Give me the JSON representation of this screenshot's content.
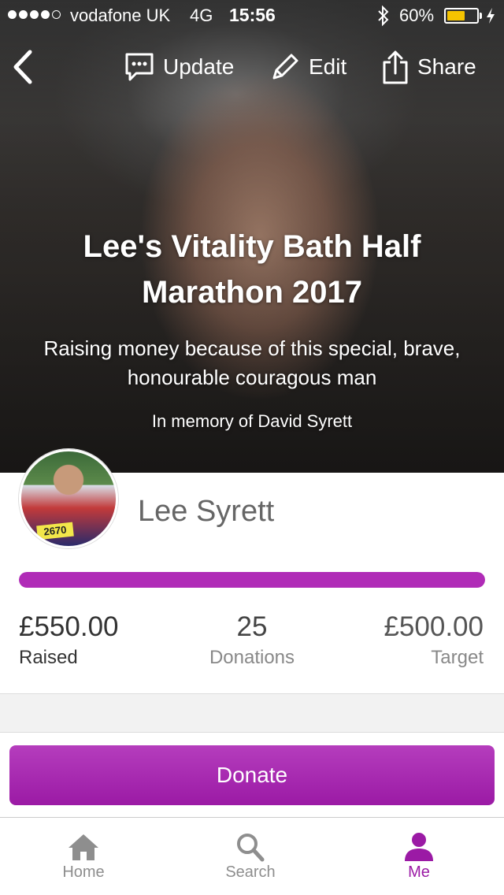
{
  "status_bar": {
    "carrier": "vodafone UK",
    "network": "4G",
    "time": "15:56",
    "battery_percent": "60%",
    "battery_level": 0.6,
    "signal_bars": 4,
    "signal_total": 5
  },
  "toolbar": {
    "update_label": "Update",
    "edit_label": "Edit",
    "share_label": "Share"
  },
  "hero": {
    "title": "Lee's Vitality Bath Half Marathon 2017",
    "subtitle": "Raising money because of this special, brave, honourable couragous man",
    "memory": "In memory of David Syrett"
  },
  "profile": {
    "name": "Lee Syrett",
    "avatar_bib": "2670"
  },
  "progress": {
    "fraction": 1.0
  },
  "stats": {
    "raised_value": "£550.00",
    "raised_label": "Raised",
    "donations_value": "25",
    "donations_label": "Donations",
    "target_value": "£500.00",
    "target_label": "Target"
  },
  "donate": {
    "label": "Donate"
  },
  "tabs": [
    {
      "label": "Home",
      "icon": "home-icon"
    },
    {
      "label": "Search",
      "icon": "search-icon"
    },
    {
      "label": "Me",
      "icon": "person-icon"
    }
  ],
  "colors": {
    "accent": "#9b1aa5",
    "progress": "#b02bb7",
    "battery": "#f5c400"
  }
}
